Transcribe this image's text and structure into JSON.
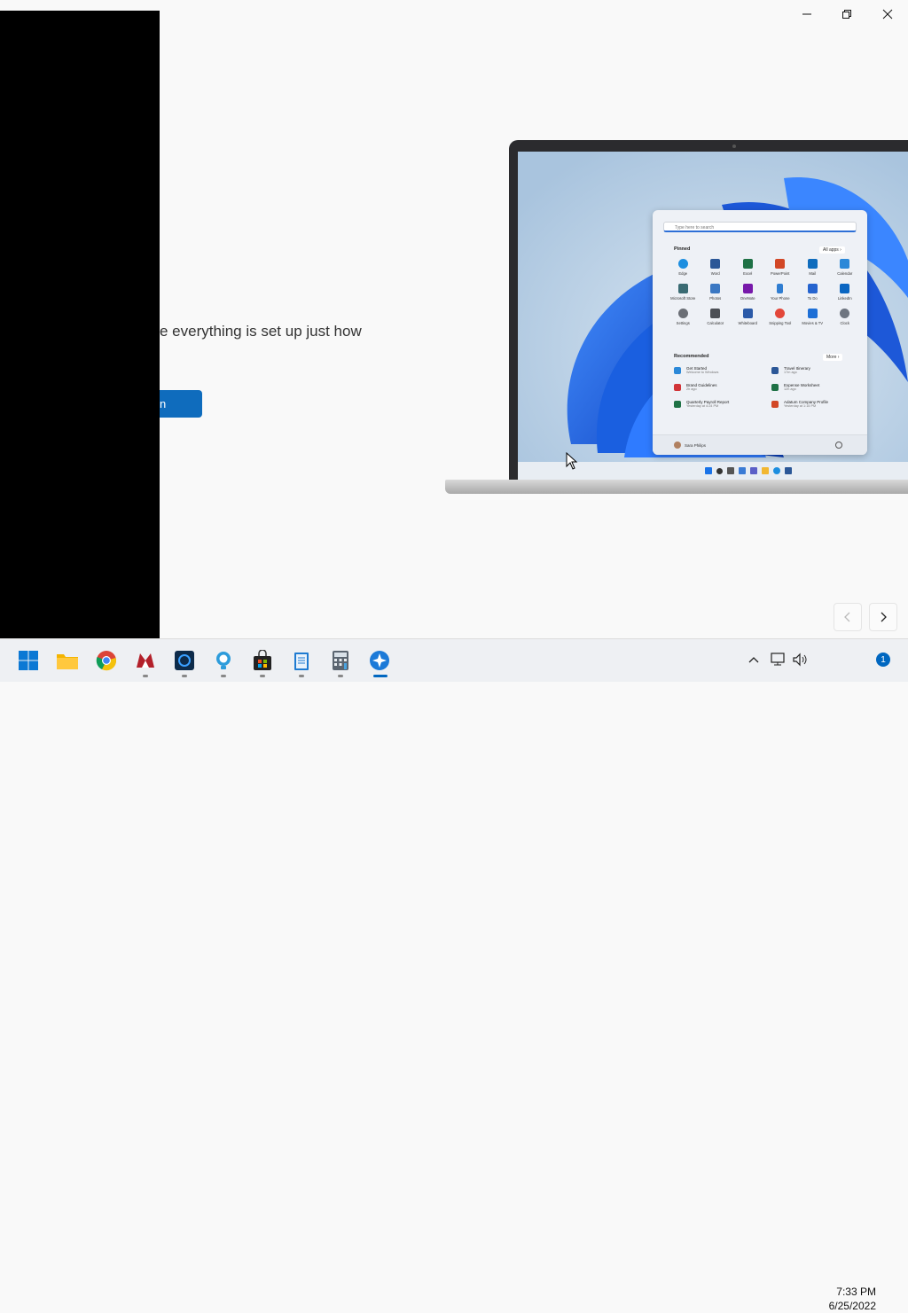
{
  "window": {
    "title_fragment": "",
    "headline": "e everything is set up just how",
    "primary_button_label": "n",
    "prev_label": "‹",
    "next_label": "›"
  },
  "laptop": {
    "search_placeholder": "Type here to search",
    "pinned_label": "Pinned",
    "all_apps_label": "All apps  ›",
    "apps": [
      {
        "name": "Edge",
        "color": "#1c8ee0"
      },
      {
        "name": "Word",
        "color": "#2b5797"
      },
      {
        "name": "Excel",
        "color": "#1e7145"
      },
      {
        "name": "PowerPoint",
        "color": "#d24726"
      },
      {
        "name": "Mail",
        "color": "#0f6cbd"
      },
      {
        "name": "Calendar",
        "color": "#2b88d8"
      },
      {
        "name": "Microsoft Store",
        "color": "#3a6b73"
      },
      {
        "name": "Photos",
        "color": "#3b78c3"
      },
      {
        "name": "OneNote",
        "color": "#7719aa"
      },
      {
        "name": "Your Phone",
        "color": "#2f7dd1"
      },
      {
        "name": "To Do",
        "color": "#2564cf"
      },
      {
        "name": "LinkedIn",
        "color": "#0a66c2"
      },
      {
        "name": "Settings",
        "color": "#6b6f76"
      },
      {
        "name": "Calculator",
        "color": "#4c4f55"
      },
      {
        "name": "Whiteboard",
        "color": "#2b5aa8"
      },
      {
        "name": "Snipping Tool",
        "color": "#e3473a"
      },
      {
        "name": "Movies & TV",
        "color": "#1d6fd6"
      },
      {
        "name": "Clock",
        "color": "#6e7580"
      }
    ],
    "recommended_label": "Recommended",
    "more_label": "More  ›",
    "recommended": [
      {
        "title": "Get Started",
        "sub": "Welcome to Windows",
        "color": "#2b88d8"
      },
      {
        "title": "Travel Itinerary",
        "sub": "17m ago",
        "color": "#2b5797"
      },
      {
        "title": "Brand Guidelines",
        "sub": "2h ago",
        "color": "#d13438"
      },
      {
        "title": "Expense Worksheet",
        "sub": "12h ago",
        "color": "#1e7145"
      },
      {
        "title": "Quarterly Payroll Report",
        "sub": "Yesterday at 4:24 PM",
        "color": "#1e7145"
      },
      {
        "title": "Adatum Company Profile",
        "sub": "Yesterday at 1:15 PM",
        "color": "#d24726"
      }
    ],
    "user_name": "Sara Philips"
  },
  "taskbar": {
    "apps": [
      {
        "name": "Start",
        "icon": "windows-logo-icon"
      },
      {
        "name": "File Explorer",
        "icon": "folder-icon"
      },
      {
        "name": "Google Chrome",
        "icon": "chrome-icon"
      },
      {
        "name": "App",
        "icon": "red-app-icon"
      },
      {
        "name": "App",
        "icon": "dark-app-icon"
      },
      {
        "name": "Tips",
        "icon": "lightbulb-icon"
      },
      {
        "name": "Microsoft Store",
        "icon": "store-icon"
      },
      {
        "name": "Notepad",
        "icon": "notepad-icon"
      },
      {
        "name": "Calculator",
        "icon": "calculator-icon"
      },
      {
        "name": "Get Started",
        "icon": "get-started-icon"
      }
    ],
    "time": "7:33 PM",
    "date": "6/25/2022",
    "notification_count": "1"
  }
}
